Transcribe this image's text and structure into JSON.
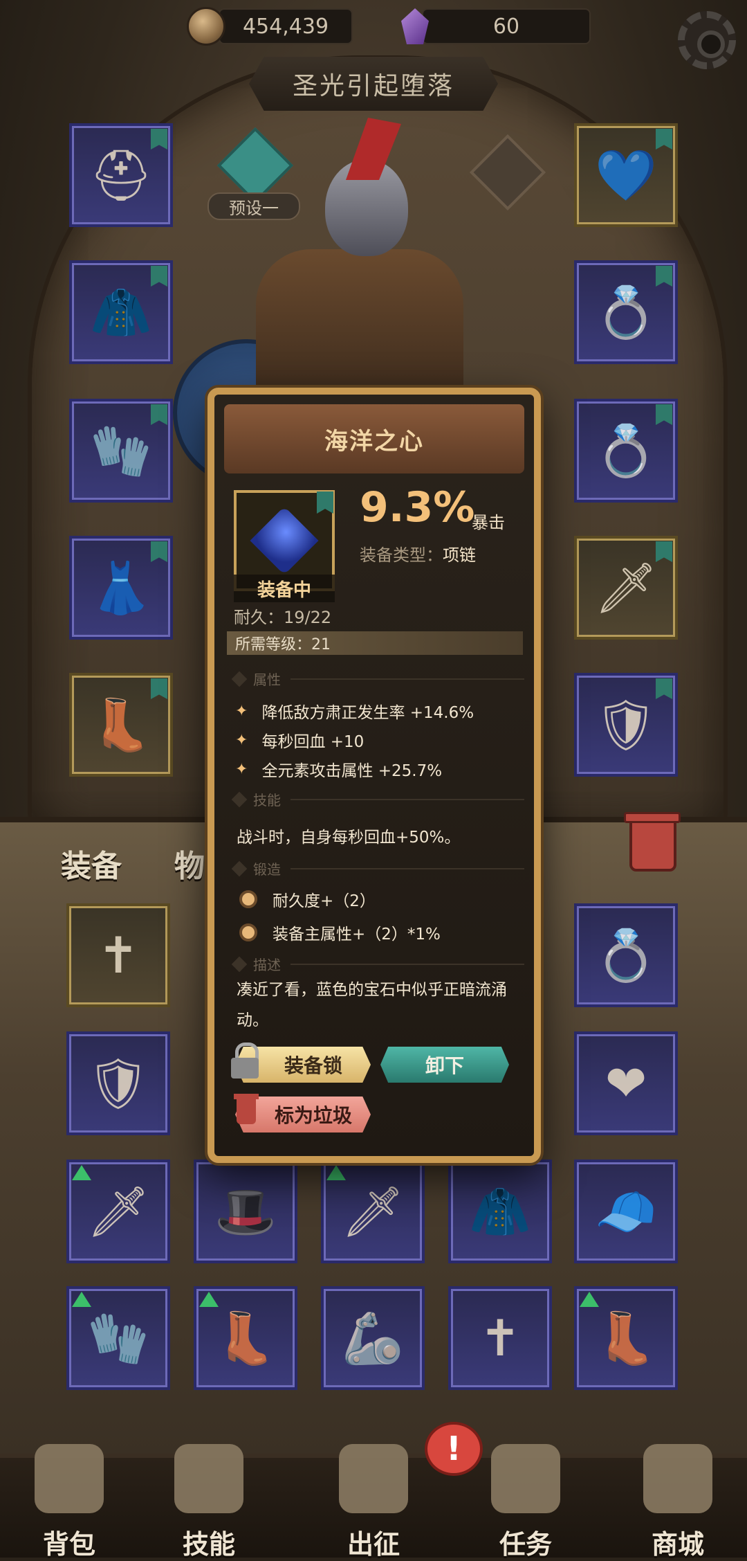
{
  "currency": {
    "coins": "454,439",
    "gems": "60"
  },
  "header": {
    "title": "圣光引起堕落"
  },
  "preset": {
    "label": "预设一"
  },
  "tabs": {
    "equipment": "装备",
    "items": "物品"
  },
  "item_detail": {
    "name": "海洋之心",
    "equipped_label": "装备中",
    "main_stat_value": "9.3%",
    "main_stat_name": "暴击",
    "type_label": "装备类型：",
    "type_value": "项链",
    "durability": "耐久：19/22",
    "required_level": "所需等级：21",
    "sections": {
      "attributes": "属性",
      "skills": "技能",
      "forge": "锻造",
      "description": "描述"
    },
    "attributes": [
      "降低敌方肃正发生率 +14.6%",
      "每秒回血 +10",
      "全元素攻击属性 +25.7%"
    ],
    "skill": "战斗时，自身每秒回血+50%。",
    "forge": [
      "耐久度+（2）",
      "装备主属性+（2）*1%"
    ],
    "description": "凑近了看，蓝色的宝石中似乎正暗流涌动。",
    "buttons": {
      "lock": "装备锁",
      "unequip": "卸下",
      "mark_trash": "标为垃圾"
    }
  },
  "nav": [
    {
      "label": "背包",
      "icon": "backpack-icon"
    },
    {
      "label": "技能",
      "icon": "skill-book-icon"
    },
    {
      "label": "出征",
      "icon": "expedition-map-icon"
    },
    {
      "label": "任务",
      "icon": "quest-scroll-icon"
    },
    {
      "label": "商城",
      "icon": "shop-crown-icon"
    }
  ],
  "colors": {
    "accent_gold": "#c99a52",
    "unequip_teal": "#2a7a6e",
    "trash_red": "#d7776a",
    "rare_slot_purple": "#3a3a78"
  }
}
